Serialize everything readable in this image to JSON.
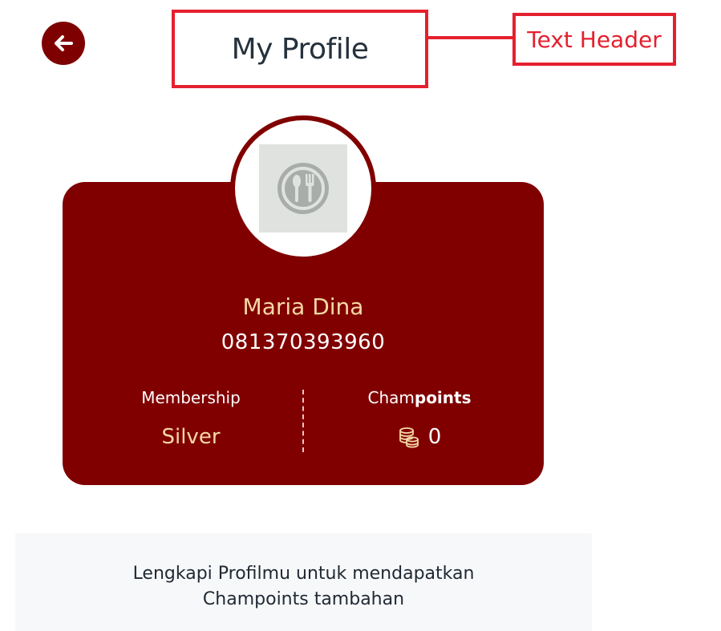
{
  "header": {
    "title": "My Profile",
    "annotation": "Text Header",
    "back_icon": "arrow-left-icon"
  },
  "profile": {
    "name": "Maria Dina",
    "phone": "081370393960",
    "avatar_icon": "restaurant-placeholder-icon"
  },
  "stats": {
    "membership_label": "Membership",
    "membership_value": "Silver",
    "points_label_prefix": "Cham",
    "points_label_bold": "points",
    "points_value": "0",
    "points_icon": "coins-icon"
  },
  "banner": {
    "line1": "Lengkapi Profilmu untuk mendapatkan",
    "line2": "Champoints tambahan"
  },
  "colors": {
    "brand": "#800000",
    "accent_text": "#f6d8a6",
    "annotation": "#e5202e"
  }
}
